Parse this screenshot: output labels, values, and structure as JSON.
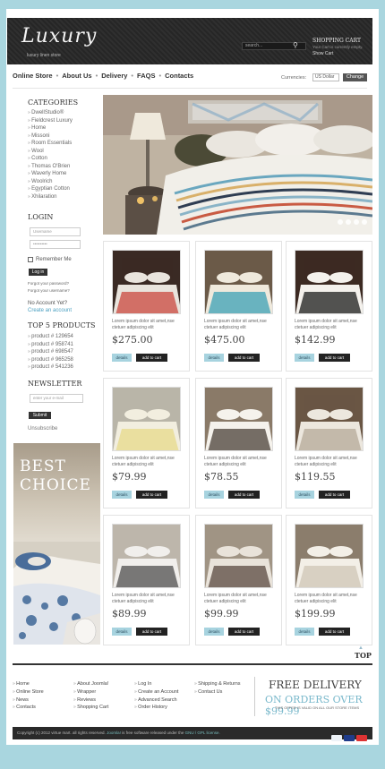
{
  "header": {
    "logo": "Luxury",
    "tagline": "luxury linen store",
    "search_placeholder": "search...",
    "cart_title": "SHOPPING CART",
    "cart_text": "Your Cart is currently empty.",
    "cart_link": "Show Cart"
  },
  "nav": {
    "items": [
      "Online Store",
      "About Us",
      "Delivery",
      "FAQS",
      "Contacts"
    ],
    "currencies_label": "Currencies:",
    "currency_value": "US Dollar",
    "change_label": "Change"
  },
  "sidebar": {
    "categories_title": "CATEGORIES",
    "categories": [
      "DwellStudio®",
      "Fieldcrest Luxury",
      "Home",
      "Missoni",
      "Room Essentials",
      "Wool",
      "Cotton",
      "Thomas O'Brien",
      "Waverly Home",
      "Woolrich",
      "Egyptian Cotton",
      "Xhilaration"
    ],
    "login_title": "LOGIN",
    "username_placeholder": "Username",
    "password_placeholder": "••••••••••",
    "remember_label": "Remember Me",
    "login_button": "Log in",
    "forgot_password": "Forgot your password?",
    "forgot_username": "Forgot your username?",
    "no_account": "No Account Yet?",
    "create_account": "Create an account",
    "top5_title": "TOP 5 PRODUCTS",
    "top5": [
      "product # 129654",
      "product # 958741",
      "product # 698547",
      "product # 965258",
      "product # 541236"
    ],
    "newsletter_title": "NEWSLETTER",
    "email_placeholder": "enter your e-mail",
    "subscribe_button": "Submit",
    "unsubscribe": "Unsubscribe",
    "banner_line1": "BEST",
    "banner_line2": "CHOICE"
  },
  "products": [
    {
      "desc": "Lorem ipsum dolor sit amet,nse ctetuer adipiscing elit",
      "price": "$275.00",
      "details": "details",
      "add": "add to cart",
      "palette": [
        "#3a2a24",
        "#c9483d",
        "#e9e4dd"
      ]
    },
    {
      "desc": "Lorem ipsum dolor sit amet,nse ctetuer adipiscing elit",
      "price": "$475.00",
      "details": "details",
      "add": "add to cart",
      "palette": [
        "#6b5a48",
        "#3ca0b6",
        "#efe9dc"
      ]
    },
    {
      "desc": "Lorem ipsum dolor sit amet,nse ctetuer adipiscing elit",
      "price": "$142.99",
      "details": "details",
      "add": "add to cart",
      "palette": [
        "#3c2a22",
        "#1c1c1c",
        "#f4f1ec"
      ]
    },
    {
      "desc": "Lorem ipsum dolor sit amet,nse ctetuer adipiscing elit",
      "price": "$79.99",
      "details": "details",
      "add": "add to cart",
      "palette": [
        "#b9b5a8",
        "#e7d98a",
        "#f2eedf"
      ]
    },
    {
      "desc": "Lorem ipsum dolor sit amet,nse ctetuer adipiscing elit",
      "price": "$78.55",
      "details": "details",
      "add": "add to cart",
      "palette": [
        "#8a7a68",
        "#4a4038",
        "#f5f2ec"
      ]
    },
    {
      "desc": "Lorem ipsum dolor sit amet,nse ctetuer adipiscing elit",
      "price": "$119.55",
      "details": "details",
      "add": "add to cart",
      "palette": [
        "#6a5644",
        "#b6aa98",
        "#ece7de"
      ]
    },
    {
      "desc": "Lorem ipsum dolor sit amet,nse ctetuer adipiscing elit",
      "price": "$89.99",
      "details": "details",
      "add": "add to cart",
      "palette": [
        "#bdb6ab",
        "#4f4f4f",
        "#f1efec"
      ]
    },
    {
      "desc": "Lorem ipsum dolor sit amet,nse ctetuer adipiscing elit",
      "price": "$99.99",
      "details": "details",
      "add": "add to cart",
      "palette": [
        "#a09484",
        "#5a4a40",
        "#e9e3da"
      ]
    },
    {
      "desc": "Lorem ipsum dolor sit amet,nse ctetuer adipiscing elit",
      "price": "$199.99",
      "details": "details",
      "add": "add to cart",
      "palette": [
        "#8b7d6c",
        "#cfc6b6",
        "#f3efe7"
      ]
    }
  ],
  "top_label": "TOP",
  "footer": {
    "col1": [
      "Home",
      "Online Store",
      "News",
      "Contacts"
    ],
    "col2": [
      "About Joomla!",
      "Wrapper",
      "Reviews",
      "Shopping Cart"
    ],
    "col3": [
      "Log In",
      "Create an Account",
      "Advanced Search",
      "Order History"
    ],
    "col4": [
      "Shipping & Returns",
      "Contact Us"
    ],
    "free_line1": "FREE DELIVERY",
    "free_line2": "ON ORDERS OVER $99.99",
    "free_line3": "THIS OFFER IS VALID ON ALL OUR STORE ITEMS",
    "copyright": "Copyright (c) 2012 virtue mart. all rights reserved.",
    "copyright_link": "Joomla!",
    "copyright_mid": "is free software released under the",
    "license_link": "GNU / GPL license."
  }
}
